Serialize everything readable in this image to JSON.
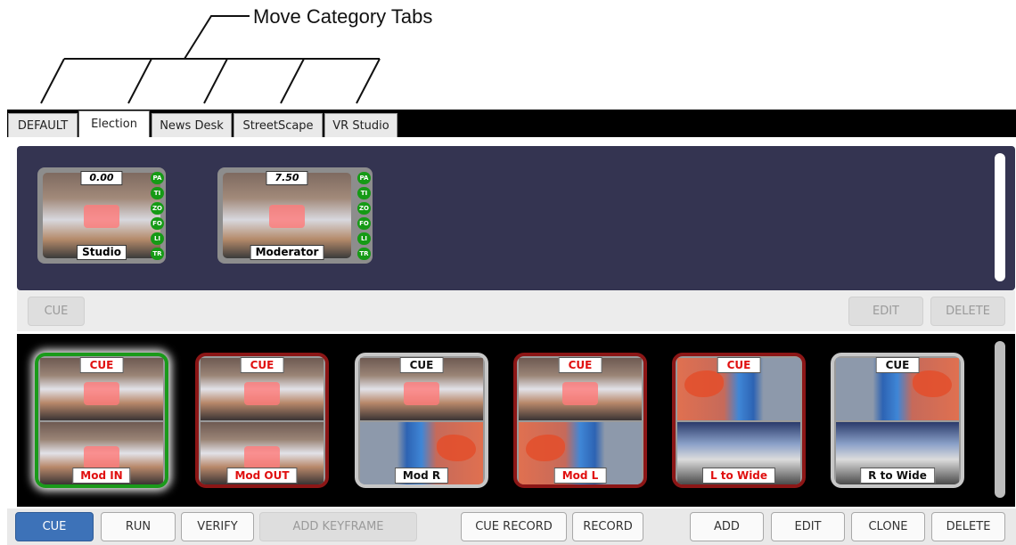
{
  "annotation": {
    "callout": "Move Category Tabs"
  },
  "tabs": [
    {
      "label": "DEFAULT",
      "active": false
    },
    {
      "label": "Election",
      "active": true
    },
    {
      "label": "News Desk",
      "active": false
    },
    {
      "label": "StreetScape",
      "active": false
    },
    {
      "label": "VR Studio",
      "active": false
    }
  ],
  "cameras": [
    {
      "name": "Studio",
      "value": "0.00",
      "badges": [
        "PA",
        "TI",
        "ZO",
        "FO",
        "LI",
        "TR"
      ]
    },
    {
      "name": "Moderator",
      "value": "7.50",
      "badges": [
        "PA",
        "TI",
        "ZO",
        "FO",
        "LI",
        "TR"
      ]
    }
  ],
  "upper_toolbar": {
    "cue": "CUE",
    "edit": "EDIT",
    "delete": "DELETE"
  },
  "keyframes": [
    {
      "top": "CUE",
      "name": "Mod IN",
      "border": "green",
      "scene": "studio"
    },
    {
      "top": "CUE",
      "name": "Mod OUT",
      "border": "red",
      "scene": "studio"
    },
    {
      "top": "CUE",
      "name": "Mod R",
      "border": "grey",
      "scene": "studio-map"
    },
    {
      "top": "CUE",
      "name": "Mod L",
      "border": "red",
      "scene": "studio-map"
    },
    {
      "top": "CUE",
      "name": "L to Wide",
      "border": "red",
      "scene": "map-studio"
    },
    {
      "top": "CUE",
      "name": "R to Wide",
      "border": "grey",
      "scene": "map-studio"
    }
  ],
  "lower_toolbar": {
    "cue": "CUE",
    "run": "RUN",
    "verify": "VERIFY",
    "add_keyframe": "ADD KEYFRAME",
    "cue_record": "CUE RECORD",
    "record": "RECORD",
    "add": "ADD",
    "edit": "EDIT",
    "clone": "CLONE",
    "delete": "DELETE"
  },
  "colors": {
    "panel": "#343451",
    "accent": "#3d72b8",
    "badge": "#159a15",
    "active_border": "#1a9a1a",
    "alert_border": "#8c1616"
  }
}
